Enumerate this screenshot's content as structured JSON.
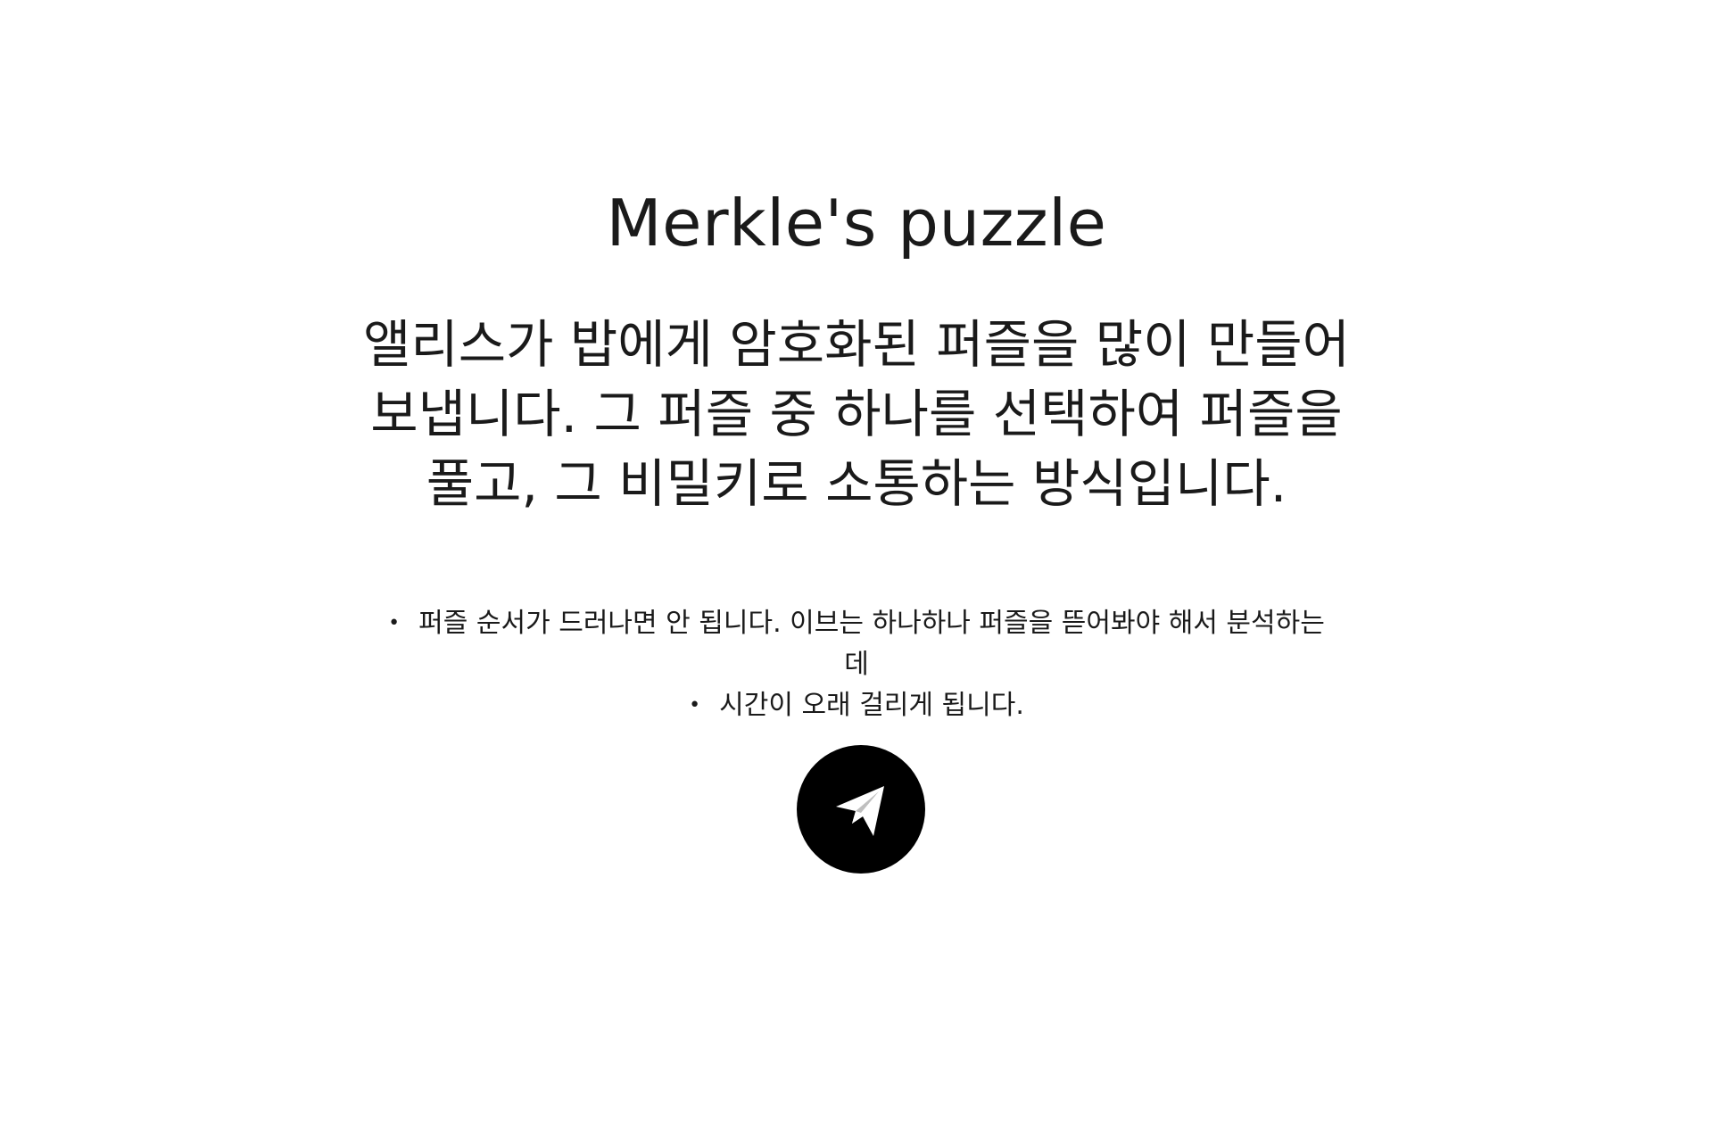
{
  "title": "Merkle's puzzle",
  "description": "앨리스가 밥에게 암호화된 퍼즐을 많이 만들어 보냅니다. 그 퍼즐 중 하나를 선택하여 퍼즐을 풀고, 그 비밀키로 소통하는 방식입니다.",
  "notes": [
    {
      "bullet": "•",
      "text": "퍼즐 순서가 드러나면 안 됩니다. 이브는 하나하나 퍼즐을 뜯어봐야 해서 분석하는데"
    },
    {
      "bullet": "•",
      "text": "시간이 오래 걸리게 됩니다."
    }
  ],
  "send_button": {
    "icon": "paper-plane-icon"
  },
  "colors": {
    "background": "#ffffff",
    "text": "#1a1a1a",
    "button": "#000000",
    "icon": "#ffffff"
  }
}
